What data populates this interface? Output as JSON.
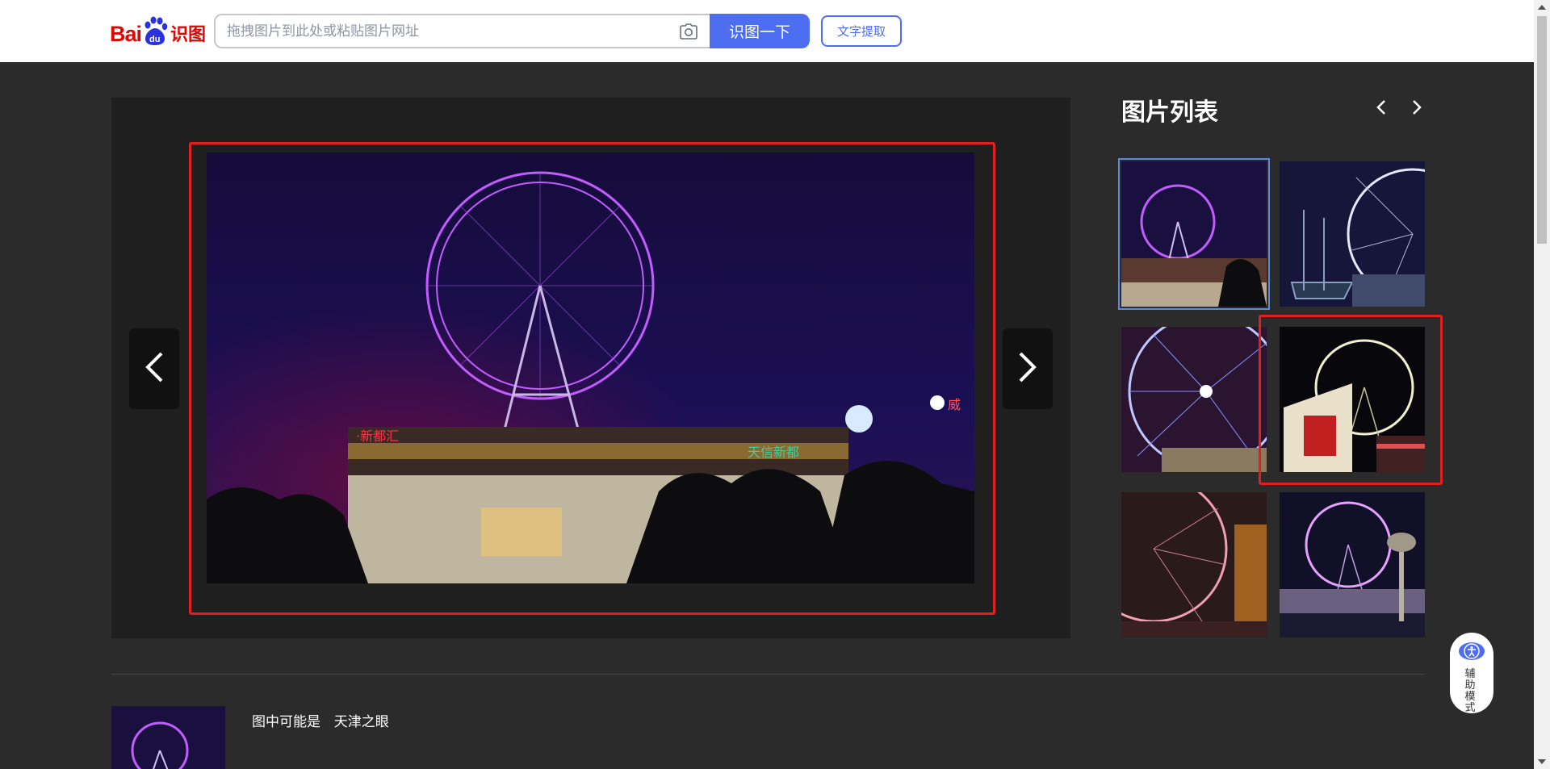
{
  "header": {
    "logo_bai": "Bai",
    "logo_du": "du",
    "logo_shitu": "识图",
    "search_placeholder": "拖拽图片到此处或粘贴图片网址",
    "search_button": "识图一下",
    "text_extract_button": "文字提取"
  },
  "sidebar": {
    "title": "图片列表",
    "thumbnails": [
      {
        "theme": "purple-wheel-mall",
        "selected": true
      },
      {
        "theme": "white-wheel-ship",
        "selected": false
      },
      {
        "theme": "blue-wheel-closeup",
        "selected": false
      },
      {
        "theme": "white-wheel-billboard",
        "selected": false
      },
      {
        "theme": "pink-wheel-street",
        "selected": false
      },
      {
        "theme": "pink-blue-wheel-river",
        "selected": false
      }
    ]
  },
  "main": {
    "prev_icon": "chevron-left-icon",
    "next_icon": "chevron-right-icon"
  },
  "result": {
    "prefix": "图中可能是",
    "name": "天津之眼"
  },
  "assist": {
    "label": "辅助模式"
  },
  "colors": {
    "accent": "#4e6ef2",
    "brand_red": "#e10601",
    "highlight_frame": "#e02020",
    "page_bg": "#2b2b2b",
    "viewer_bg": "#1f1f1f"
  }
}
